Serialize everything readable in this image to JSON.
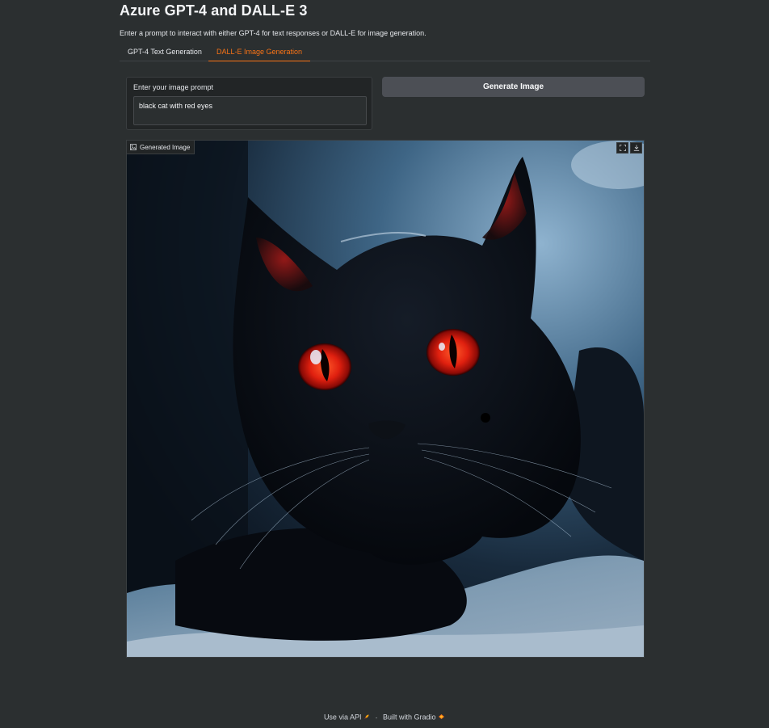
{
  "page": {
    "title": "Azure GPT-4 and DALL-E 3",
    "subtitle": "Enter a prompt to interact with either GPT-4 for text responses or DALL-E for image generation."
  },
  "tabs": [
    {
      "label": "GPT-4 Text Generation",
      "selected": false
    },
    {
      "label": "DALL-E Image Generation",
      "selected": true
    }
  ],
  "prompt": {
    "label": "Enter your image prompt",
    "value": "black cat with red eyes"
  },
  "generate_button": {
    "label": "Generate Image"
  },
  "image_output": {
    "label": "Generated Image",
    "icon": "image-icon",
    "tools": [
      "fullscreen-icon",
      "download-icon"
    ]
  },
  "footer": {
    "api_label": "Use via API",
    "separator": "·",
    "built_label": "Built with Gradio"
  },
  "colors": {
    "background": "#2b2f30",
    "accent": "#f97316",
    "button": "#4c4f55"
  }
}
